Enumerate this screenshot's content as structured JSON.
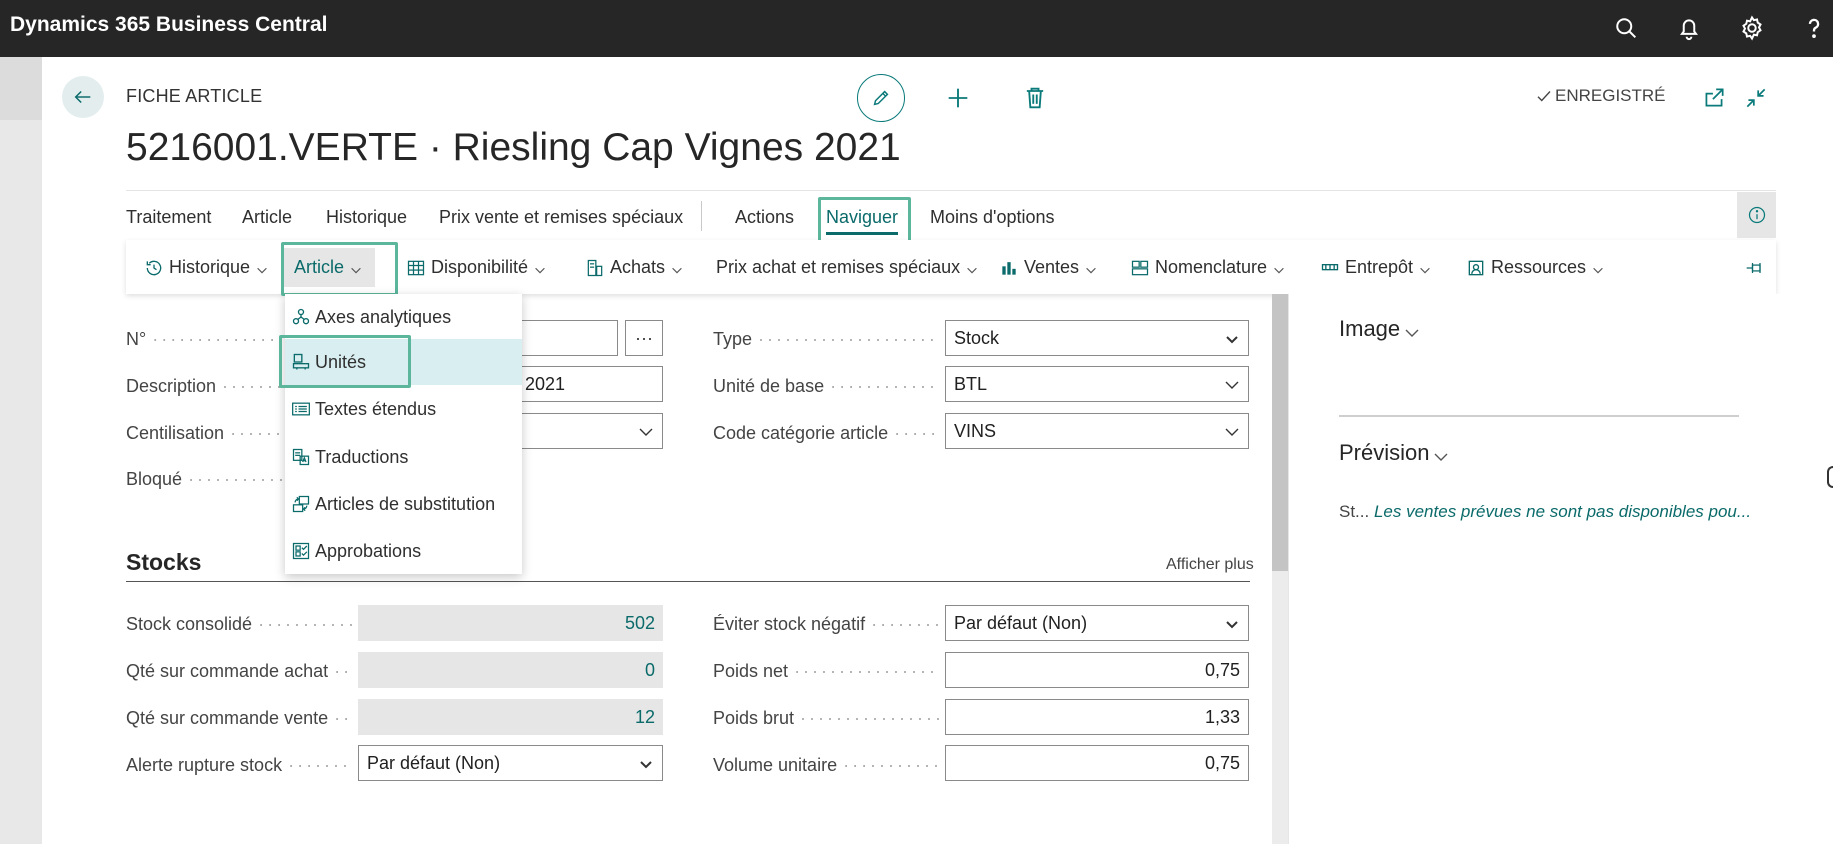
{
  "app": {
    "title": "Dynamics 365 Business Central",
    "icons": [
      "search-icon",
      "bell-icon",
      "gear-icon",
      "help-icon"
    ]
  },
  "header": {
    "caption": "FICHE ARTICLE",
    "title": "5216001.VERTE · Riesling Cap Vignes 2021",
    "status": "ENREGISTRÉ"
  },
  "action_tabs": [
    {
      "label": "Traitement"
    },
    {
      "label": "Article"
    },
    {
      "label": "Historique"
    },
    {
      "label": "Prix vente et remises spéciaux"
    },
    {
      "label": "Actions"
    },
    {
      "label": "Naviguer"
    },
    {
      "label": "Moins d'options"
    }
  ],
  "submenu": [
    {
      "label": "Historique"
    },
    {
      "label": "Article"
    },
    {
      "label": "Disponibilité"
    },
    {
      "label": "Achats"
    },
    {
      "label": "Prix achat et remises spéciaux"
    },
    {
      "label": "Ventes"
    },
    {
      "label": "Nomenclature"
    },
    {
      "label": "Entrepôt"
    },
    {
      "label": "Ressources"
    }
  ],
  "dropdown": [
    {
      "label": "Axes analytiques"
    },
    {
      "label": "Unités"
    },
    {
      "label": "Textes étendus"
    },
    {
      "label": "Traductions"
    },
    {
      "label": "Articles de substitution"
    },
    {
      "label": "Approbations"
    }
  ],
  "general": {
    "no_label": "N°",
    "description_label": "Description",
    "description_value": "2021",
    "centilisation_label": "Centilisation",
    "bloque_label": "Bloqué",
    "type_label": "Type",
    "type_value": "Stock",
    "unite_label": "Unité de base",
    "unite_value": "BTL",
    "categorie_label": "Code catégorie article",
    "categorie_value": "VINS"
  },
  "stocks": {
    "title": "Stocks",
    "show_more": "Afficher plus",
    "stock_label": "Stock consolidé",
    "stock_value": "502",
    "qte_achat_label": "Qté sur commande achat",
    "qte_achat_value": "0",
    "qte_vente_label": "Qté sur commande vente",
    "qte_vente_value": "12",
    "alerte_label": "Alerte rupture stock",
    "alerte_value": "Par défaut (Non)",
    "eviter_label": "Éviter stock négatif",
    "eviter_value": "Par défaut (Non)",
    "poids_net_label": "Poids net",
    "poids_net_value": "0,75",
    "poids_brut_label": "Poids brut",
    "poids_brut_value": "1,33",
    "volume_label": "Volume unitaire",
    "volume_value": "0,75"
  },
  "factbox": {
    "image_title": "Image",
    "prevision_title": "Prévision",
    "prevision_prefix": "St...",
    "prevision_text": "Les ventes prévues ne sont pas disponibles pou..."
  },
  "colors": {
    "accent": "#0b6a6a",
    "highlight": "#5bb69b",
    "topbar": "#262626"
  }
}
